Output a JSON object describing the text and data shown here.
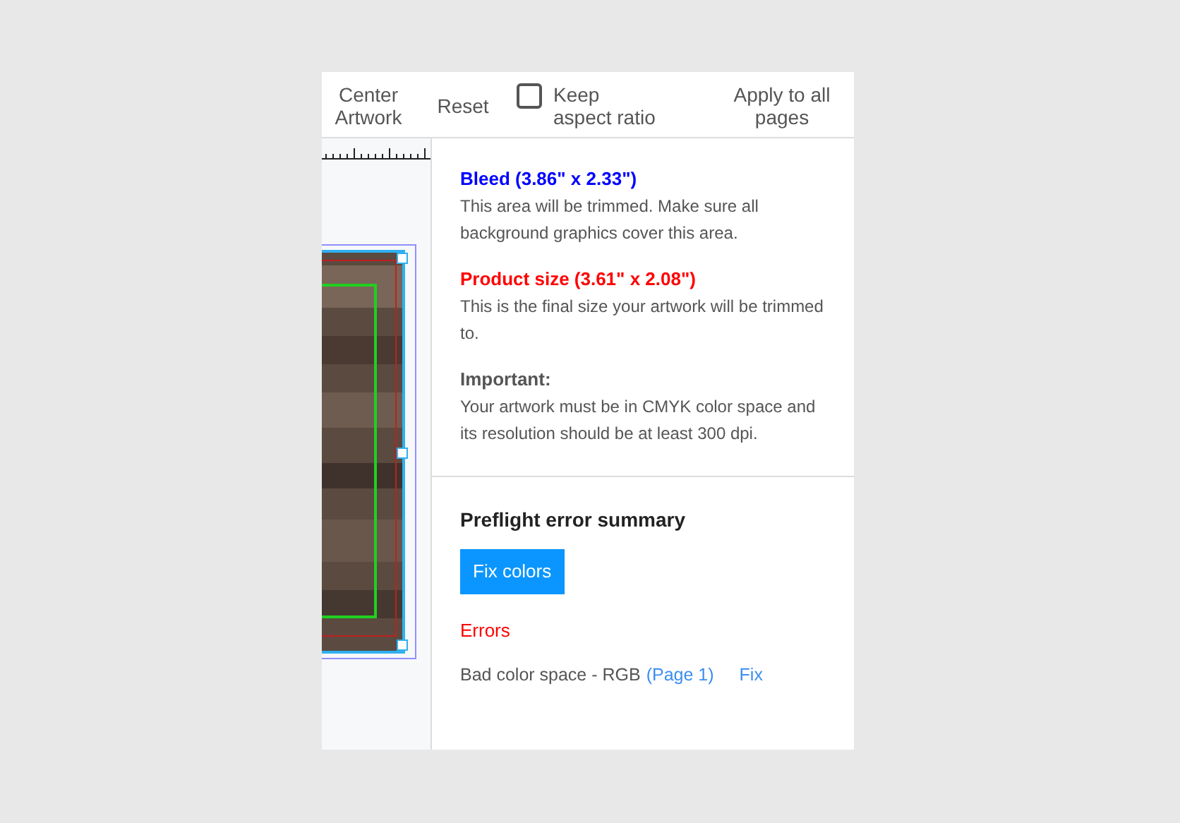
{
  "toolbar": [
    {
      "kind": "button",
      "label": "Center Artwork"
    },
    {
      "kind": "button",
      "label": "Reset"
    },
    {
      "kind": "checkbox",
      "label": "Keep aspect ratio",
      "checked": false
    },
    {
      "kind": "button",
      "label": "Apply to all pages"
    }
  ],
  "info": [
    {
      "title": "Bleed (3.86\" x 2.33\")",
      "color": "#0000ff",
      "text": "This area will be trimmed. Make sure all background graphics cover this area."
    },
    {
      "title": "Product size (3.61\" x 2.08\")",
      "color": "#ff0000",
      "text": "This is the final size your artwork will be trimmed to."
    },
    {
      "title": "Important:",
      "color": "#555555",
      "text": "Your artwork must be in CMYK color space and its resolution should be at least 300 dpi."
    }
  ],
  "preflight": {
    "title": "Preflight error summary",
    "button": "Fix colors",
    "errors_title": "Errors",
    "errors": [
      {
        "text": "Bad color space - RGB",
        "page": "(Page 1)",
        "fix": "Fix"
      }
    ]
  }
}
